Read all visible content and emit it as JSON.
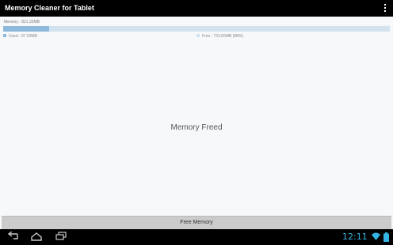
{
  "app": {
    "title": "Memory Cleaner for Tablet"
  },
  "memory": {
    "total_label": "Memory : 821.32MB",
    "used_fraction": 0.118,
    "used_label": "Used : 97.50MB",
    "free_label": "Free : 723.82MB  (88%)"
  },
  "status": {
    "message": "Memory Freed"
  },
  "actions": {
    "free_button_label": "Free Memory"
  },
  "system_bar": {
    "clock": "12:11"
  },
  "colors": {
    "used": "#8db9dd",
    "free": "#d2e3ef",
    "clock": "#33b5e5"
  },
  "icons": {
    "overflow": "overflow-menu-icon",
    "back": "back-icon",
    "home": "home-icon",
    "recents": "recent-apps-icon",
    "wifi": "wifi-icon",
    "battery": "battery-icon"
  }
}
